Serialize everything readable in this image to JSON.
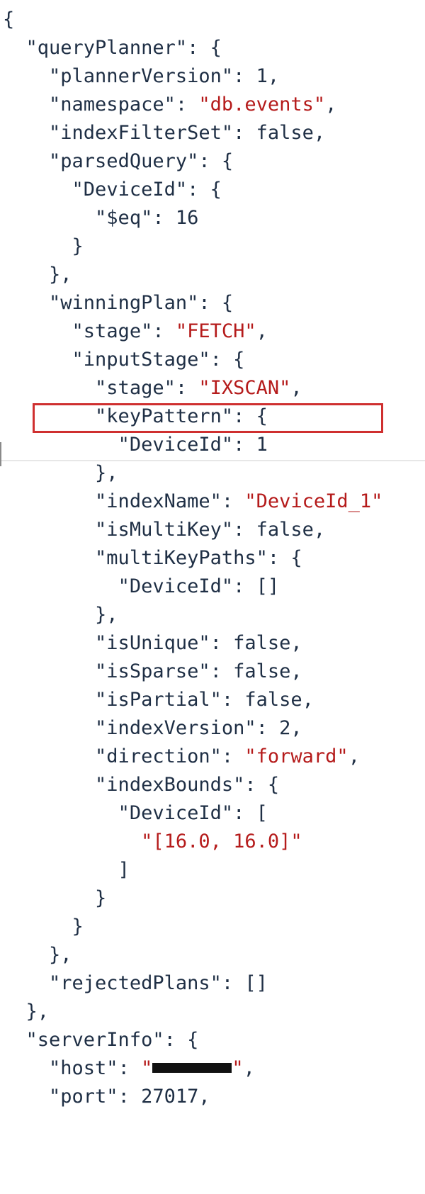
{
  "lines": [
    {
      "indent": "",
      "parts": [
        {
          "text": "{",
          "cls": "p"
        }
      ]
    },
    {
      "indent": "  ",
      "parts": [
        {
          "text": "\"queryPlanner\"",
          "cls": "k"
        },
        {
          "text": ": {",
          "cls": "p"
        }
      ]
    },
    {
      "indent": "    ",
      "parts": [
        {
          "text": "\"plannerVersion\"",
          "cls": "k"
        },
        {
          "text": ": ",
          "cls": "p"
        },
        {
          "text": "1",
          "cls": "n"
        },
        {
          "text": ",",
          "cls": "p"
        }
      ]
    },
    {
      "indent": "    ",
      "parts": [
        {
          "text": "\"namespace\"",
          "cls": "k"
        },
        {
          "text": ": ",
          "cls": "p"
        },
        {
          "text": "\"db.events\"",
          "cls": "s"
        },
        {
          "text": ",",
          "cls": "p"
        }
      ]
    },
    {
      "indent": "    ",
      "parts": [
        {
          "text": "\"indexFilterSet\"",
          "cls": "k"
        },
        {
          "text": ": ",
          "cls": "p"
        },
        {
          "text": "false",
          "cls": "b"
        },
        {
          "text": ",",
          "cls": "p"
        }
      ]
    },
    {
      "indent": "    ",
      "parts": [
        {
          "text": "\"parsedQuery\"",
          "cls": "k"
        },
        {
          "text": ": {",
          "cls": "p"
        }
      ]
    },
    {
      "indent": "      ",
      "parts": [
        {
          "text": "\"DeviceId\"",
          "cls": "k"
        },
        {
          "text": ": {",
          "cls": "p"
        }
      ]
    },
    {
      "indent": "        ",
      "parts": [
        {
          "text": "\"$eq\"",
          "cls": "k"
        },
        {
          "text": ": ",
          "cls": "p"
        },
        {
          "text": "16",
          "cls": "n"
        }
      ]
    },
    {
      "indent": "      ",
      "parts": [
        {
          "text": "}",
          "cls": "p"
        }
      ]
    },
    {
      "indent": "    ",
      "parts": [
        {
          "text": "},",
          "cls": "p"
        }
      ]
    },
    {
      "indent": "    ",
      "parts": [
        {
          "text": "\"winningPlan\"",
          "cls": "k"
        },
        {
          "text": ": {",
          "cls": "p"
        }
      ]
    },
    {
      "indent": "      ",
      "parts": [
        {
          "text": "\"stage\"",
          "cls": "k"
        },
        {
          "text": ": ",
          "cls": "p"
        },
        {
          "text": "\"FETCH\"",
          "cls": "s"
        },
        {
          "text": ",",
          "cls": "p"
        }
      ]
    },
    {
      "indent": "      ",
      "parts": [
        {
          "text": "\"inputStage\"",
          "cls": "k"
        },
        {
          "text": ": {",
          "cls": "p"
        }
      ]
    },
    {
      "indent": "        ",
      "parts": [
        {
          "text": "\"stage\"",
          "cls": "k"
        },
        {
          "text": ": ",
          "cls": "p"
        },
        {
          "text": "\"IXSCAN\"",
          "cls": "s"
        },
        {
          "text": ",",
          "cls": "p"
        }
      ]
    },
    {
      "indent": "        ",
      "parts": [
        {
          "text": "\"keyPattern\"",
          "cls": "k"
        },
        {
          "text": ": {",
          "cls": "p"
        }
      ]
    },
    {
      "indent": "          ",
      "parts": [
        {
          "text": "\"DeviceId\"",
          "cls": "k"
        },
        {
          "text": ": ",
          "cls": "p"
        },
        {
          "text": "1",
          "cls": "n"
        }
      ]
    },
    {
      "indent": "        ",
      "parts": [
        {
          "text": "},",
          "cls": "p"
        }
      ]
    },
    {
      "indent": "        ",
      "parts": [
        {
          "text": "\"indexName\"",
          "cls": "k"
        },
        {
          "text": ": ",
          "cls": "p"
        },
        {
          "text": "\"DeviceId_1\"",
          "cls": "s"
        }
      ]
    },
    {
      "indent": "        ",
      "parts": [
        {
          "text": "\"isMultiKey\"",
          "cls": "k"
        },
        {
          "text": ": ",
          "cls": "p"
        },
        {
          "text": "false",
          "cls": "b"
        },
        {
          "text": ",",
          "cls": "p"
        }
      ]
    },
    {
      "indent": "        ",
      "parts": [
        {
          "text": "\"multiKeyPaths\"",
          "cls": "k"
        },
        {
          "text": ": {",
          "cls": "p"
        }
      ]
    },
    {
      "indent": "          ",
      "parts": [
        {
          "text": "\"DeviceId\"",
          "cls": "k"
        },
        {
          "text": ": []",
          "cls": "p"
        }
      ]
    },
    {
      "indent": "        ",
      "parts": [
        {
          "text": "},",
          "cls": "p"
        }
      ]
    },
    {
      "indent": "        ",
      "parts": [
        {
          "text": "\"isUnique\"",
          "cls": "k"
        },
        {
          "text": ": ",
          "cls": "p"
        },
        {
          "text": "false",
          "cls": "b"
        },
        {
          "text": ",",
          "cls": "p"
        }
      ]
    },
    {
      "indent": "        ",
      "parts": [
        {
          "text": "\"isSparse\"",
          "cls": "k"
        },
        {
          "text": ": ",
          "cls": "p"
        },
        {
          "text": "false",
          "cls": "b"
        },
        {
          "text": ",",
          "cls": "p"
        }
      ]
    },
    {
      "indent": "        ",
      "parts": [
        {
          "text": "\"isPartial\"",
          "cls": "k"
        },
        {
          "text": ": ",
          "cls": "p"
        },
        {
          "text": "false",
          "cls": "b"
        },
        {
          "text": ",",
          "cls": "p"
        }
      ]
    },
    {
      "indent": "        ",
      "parts": [
        {
          "text": "\"indexVersion\"",
          "cls": "k"
        },
        {
          "text": ": ",
          "cls": "p"
        },
        {
          "text": "2",
          "cls": "n"
        },
        {
          "text": ",",
          "cls": "p"
        }
      ]
    },
    {
      "indent": "        ",
      "parts": [
        {
          "text": "\"direction\"",
          "cls": "k"
        },
        {
          "text": ": ",
          "cls": "p"
        },
        {
          "text": "\"forward\"",
          "cls": "s"
        },
        {
          "text": ",",
          "cls": "p"
        }
      ]
    },
    {
      "indent": "        ",
      "parts": [
        {
          "text": "\"indexBounds\"",
          "cls": "k"
        },
        {
          "text": ": {",
          "cls": "p"
        }
      ]
    },
    {
      "indent": "          ",
      "parts": [
        {
          "text": "\"DeviceId\"",
          "cls": "k"
        },
        {
          "text": ": [",
          "cls": "p"
        }
      ]
    },
    {
      "indent": "            ",
      "parts": [
        {
          "text": "\"[16.0, 16.0]\"",
          "cls": "s"
        }
      ]
    },
    {
      "indent": "          ",
      "parts": [
        {
          "text": "]",
          "cls": "p"
        }
      ]
    },
    {
      "indent": "        ",
      "parts": [
        {
          "text": "}",
          "cls": "p"
        }
      ]
    },
    {
      "indent": "      ",
      "parts": [
        {
          "text": "}",
          "cls": "p"
        }
      ]
    },
    {
      "indent": "    ",
      "parts": [
        {
          "text": "},",
          "cls": "p"
        }
      ]
    },
    {
      "indent": "    ",
      "parts": [
        {
          "text": "\"rejectedPlans\"",
          "cls": "k"
        },
        {
          "text": ": []",
          "cls": "p"
        }
      ]
    },
    {
      "indent": "  ",
      "parts": [
        {
          "text": "},",
          "cls": "p"
        }
      ]
    },
    {
      "indent": "  ",
      "parts": [
        {
          "text": "\"serverInfo\"",
          "cls": "k"
        },
        {
          "text": ": {",
          "cls": "p"
        }
      ]
    },
    {
      "indent": "    ",
      "parts": [
        {
          "text": "\"host\"",
          "cls": "k"
        },
        {
          "text": ": ",
          "cls": "p"
        },
        {
          "text": "\"",
          "cls": "s"
        },
        {
          "redacted": true
        },
        {
          "text": "\"",
          "cls": "s"
        },
        {
          "text": ",",
          "cls": "p"
        }
      ]
    },
    {
      "indent": "    ",
      "parts": [
        {
          "text": "\"port\"",
          "cls": "k"
        },
        {
          "text": ": ",
          "cls": "p"
        },
        {
          "text": "27017",
          "cls": "n"
        },
        {
          "text": ",",
          "cls": "p"
        }
      ]
    }
  ],
  "highlight": {
    "label": "\"stage\": \"IXSCAN\","
  },
  "colors": {
    "key": "#1f2f45",
    "string": "#b51b1b",
    "highlight_border": "#cf2f2f"
  }
}
